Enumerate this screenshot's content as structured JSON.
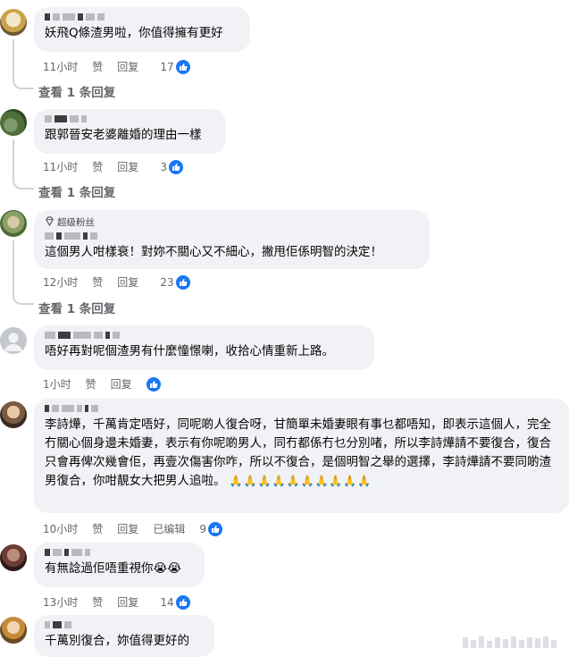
{
  "comments": [
    {
      "text": "妖飛Q條渣男啦，你值得擁有更好",
      "time": "11小时",
      "like_label": "赞",
      "reply_label": "回复",
      "edited": "",
      "likes": "17",
      "view_replies": "查看 1 条回复"
    },
    {
      "text": "跟郭晉安老婆離婚的理由一樣",
      "time": "11小时",
      "like_label": "赞",
      "reply_label": "回复",
      "edited": "",
      "likes": "3",
      "view_replies": "查看 1 条回复"
    },
    {
      "badge": "超级粉丝",
      "text": "這個男人咁樣衰！對妳不關心又不細心，撇甩佢係明智的決定！",
      "time": "12小时",
      "like_label": "赞",
      "reply_label": "回复",
      "edited": "",
      "likes": "23",
      "view_replies": "查看 1 条回复"
    },
    {
      "text": "唔好再對呢個渣男有什麼憧憬喇，收拾心情重新上路。",
      "time": "1小时",
      "like_label": "赞",
      "reply_label": "回复",
      "edited": "",
      "likes": "",
      "view_replies": ""
    },
    {
      "text": "李詩燁，千萬肯定唔好，同呢啲人復合呀，甘簡單未婚妻眼有事乜都唔知，即表示這個人，完全冇關心個身邊未婚妻，表示有你呢啲男人，同冇都係冇乜分別啫，所以李詩燁請不要復合，復合只會再俾次幾會佢，再壹次傷害你咋，所以不復合，是個明智之舉的選擇，李詩燁請不要同啲渣男復合，你咁靚女大把男人追啦。",
      "emoji": "🙏🙏🙏🙏🙏🙏🙏🙏🙏🙏",
      "time": "10小时",
      "like_label": "赞",
      "reply_label": "回复",
      "edited": "已编辑",
      "likes": "9",
      "view_replies": ""
    },
    {
      "text": "有無諗過佢唔重視你😭😭",
      "time": "13小时",
      "like_label": "赞",
      "reply_label": "回复",
      "edited": "",
      "likes": "14",
      "view_replies": ""
    },
    {
      "text": "千萬別復合，妳值得更好的",
      "time": "",
      "like_label": "",
      "reply_label": "",
      "edited": "",
      "likes": "",
      "view_replies": ""
    }
  ],
  "colors": {
    "bubble": "#f0f2f5",
    "meta": "#65676b",
    "like_blue": "#1877f2",
    "thread_line": "#cfd3d8"
  },
  "icons": {
    "like": "thumbs-up-icon",
    "badge": "diamond-icon"
  }
}
